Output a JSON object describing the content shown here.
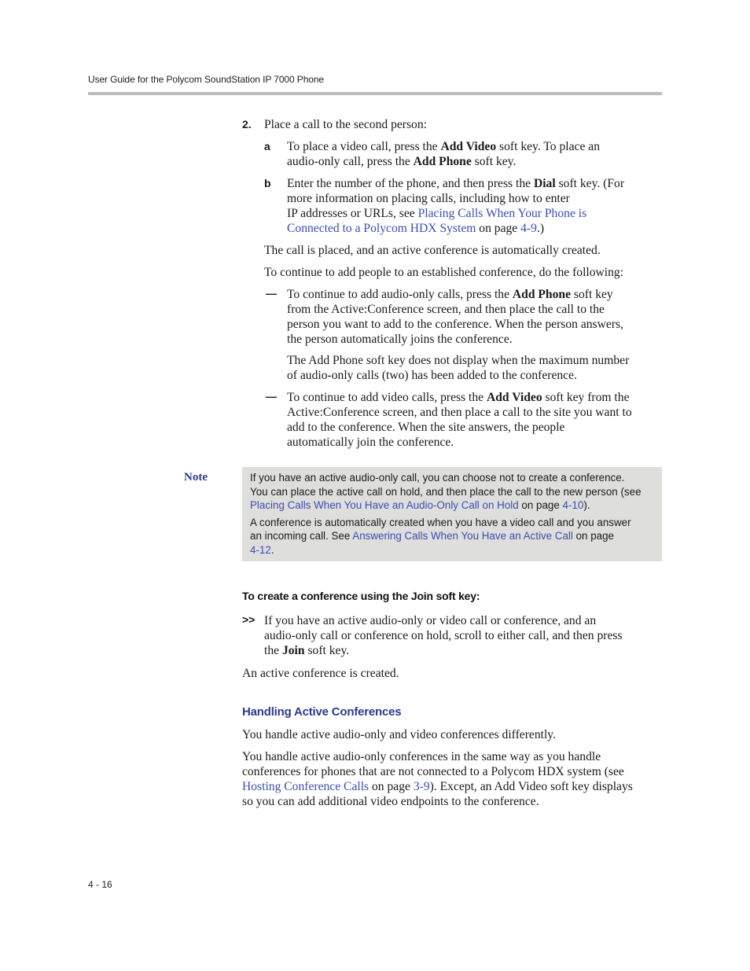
{
  "header": {
    "title": "User Guide for the Polycom SoundStation IP 7000 Phone"
  },
  "step2": {
    "number": "2.",
    "text": "Place a call to the second person:",
    "sub_a": {
      "label": "a",
      "t1": "To place a video call, press the ",
      "b1": "Add Video",
      "t2": " soft key. To place an",
      "t3": "audio-only call, press the ",
      "b2": "Add Phone",
      "t4": " soft key."
    },
    "sub_b": {
      "label": "b",
      "t1": "Enter the number of the phone, and then press the ",
      "b1": "Dial",
      "t2": " soft key. (For",
      "t3": "more information on placing calls, including how to enter",
      "t4": "IP addresses or URLs, see ",
      "link1": "Placing Calls When Your Phone is",
      "link2": "Connected to a Polycom HDX System",
      "t5": " on page ",
      "page_link": "4-9",
      "t6": ".)"
    }
  },
  "paragraphs": {
    "call_placed": "The call is placed, and an active conference is automatically created.",
    "continue_intro": "To continue to add people to an established conference, do the following:"
  },
  "bullets": [
    {
      "dash": "—",
      "l1a": "To continue to add audio-only calls, press the ",
      "l1b": "Add Phone",
      "l1c": " soft key",
      "l2": "from the Active:Conference screen, and then place the call to the",
      "l3": "person you want to add to the conference. When the person answers,",
      "l4": "the person automatically joins the conference.",
      "note_l1": "The Add Phone soft key does not display when the maximum number",
      "note_l2": "of audio-only calls (two) has been added to the conference."
    },
    {
      "dash": "—",
      "l1a": "To continue to add video calls, press the ",
      "l1b": "Add Video",
      "l1c": " soft key from the",
      "l2": "Active:Conference screen, and then place a call to the site you want to",
      "l3": "add to the conference. When the site answers, the people",
      "l4": "automatically join the conference."
    }
  ],
  "note": {
    "label": "Note",
    "p1_l1": "If you have an active audio-only call, you can choose not to create a conference.",
    "p1_l2": "You can place the active call on hold, and then place the call to the new person (see",
    "p1_link": "Placing Calls When You Have an Audio-Only Call on Hold",
    "p1_t3": " on page ",
    "p1_page": "4-10",
    "p1_end": ").",
    "p2_l1": "A conference is automatically created when you have a video call and you answer",
    "p2_l2a": "an incoming call. See ",
    "p2_link": "Answering Calls When You Have an Active Call",
    "p2_l2b": " on page",
    "p2_page": "4-12",
    "p2_end": "."
  },
  "procedure": {
    "heading": "To create a conference using the Join soft key:",
    "arrows": ">>",
    "l1": "If you have an active audio-only or video call or conference, and an",
    "l2": "audio-only call or conference on hold, scroll to either call, and then press",
    "l3a": "the ",
    "l3b": "Join",
    "l3c": " soft key.",
    "result": "An active conference is created."
  },
  "section": {
    "heading": "Handling Active Conferences",
    "p1": "You handle active audio-only and video conferences differently.",
    "p2_l1": "You handle active audio-only conferences in the same way as you handle",
    "p2_l2": "conferences for phones that are not connected to a Polycom HDX system (see",
    "p2_link": "Hosting Conference Calls",
    "p2_t3": " on page ",
    "p2_page": "3-9",
    "p2_t4": "). Except, an Add Video soft key displays",
    "p2_l4": "so you can add additional video endpoints to the conference."
  },
  "footer": {
    "page_number": "4 - 16"
  }
}
